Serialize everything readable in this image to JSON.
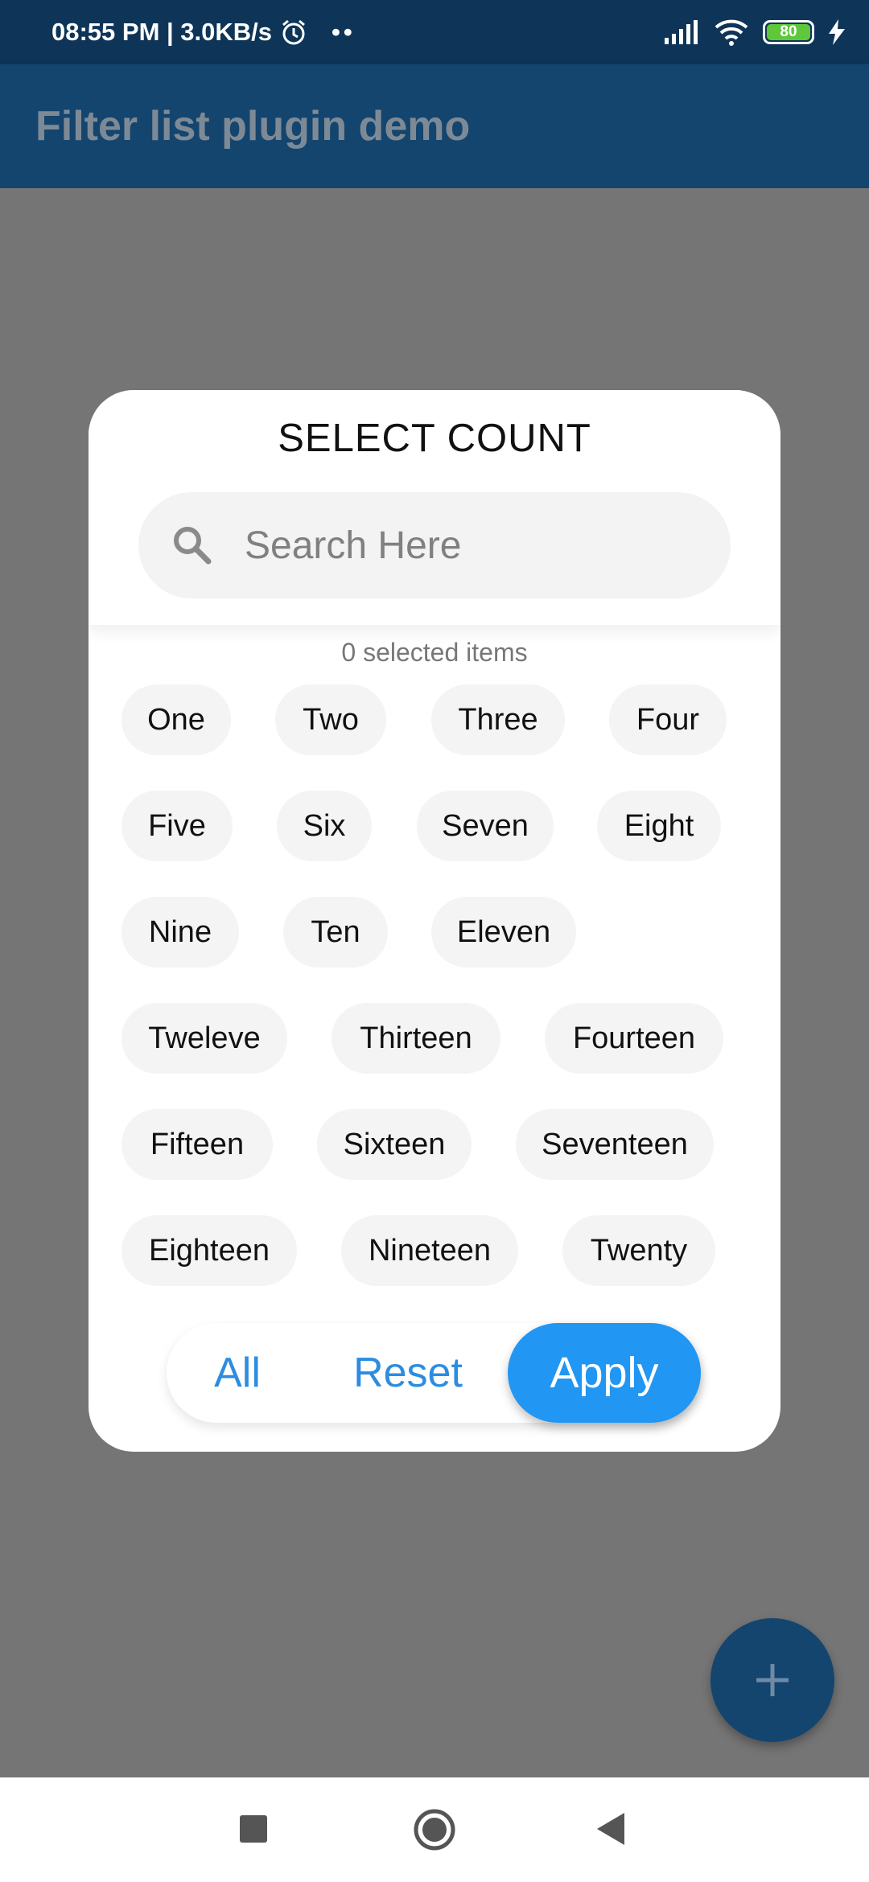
{
  "status_bar": {
    "time": "08:55 PM | 3.0KB/s",
    "battery_level": "80",
    "dots": "••"
  },
  "app_bar": {
    "title": "Filter list plugin demo"
  },
  "dialog": {
    "title": "SELECT COUNT",
    "search_placeholder": "Search Here",
    "selected_text": "0 selected items",
    "chips": [
      "One",
      "Two",
      "Three",
      "Four",
      "Five",
      "Six",
      "Seven",
      "Eight",
      "Nine",
      "Ten",
      "Eleven",
      "Tweleve",
      "Thirteen",
      "Fourteen",
      "Fifteen",
      "Sixteen",
      "Seventeen",
      "Eighteen",
      "Nineteen",
      "Twenty"
    ],
    "actions": {
      "all": "All",
      "reset": "Reset",
      "apply": "Apply"
    }
  },
  "fab": {
    "icon": "plus-icon"
  },
  "colors": {
    "accent": "#2196f3",
    "app_bar": "#13456f",
    "status_bar": "#0e3558",
    "backdrop": "#757575"
  }
}
